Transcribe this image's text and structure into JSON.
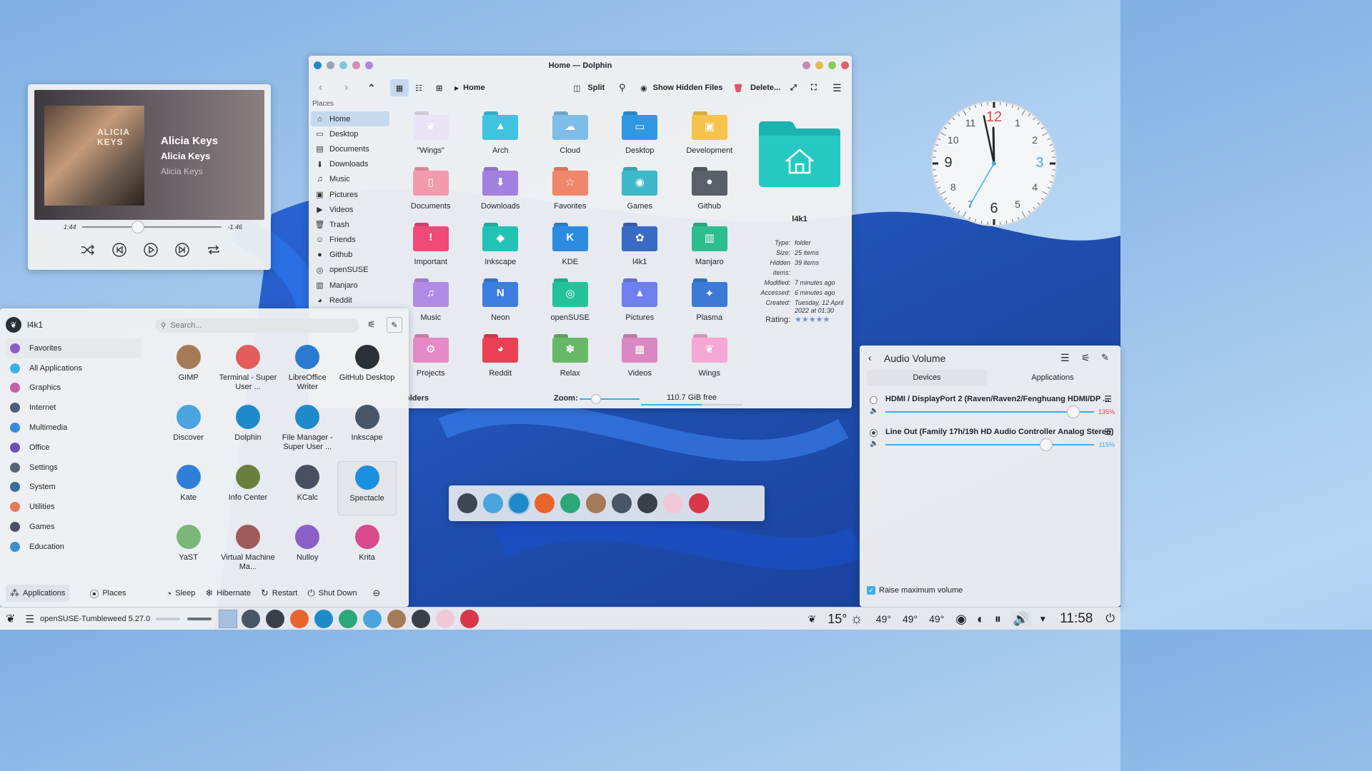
{
  "media_player": {
    "album_cover_text": "ALICIA KEYS",
    "title": "Alicia Keys",
    "album": "Alicia Keys",
    "artist": "Alicia Keys",
    "elapsed": "1:44",
    "remaining": "-1:46",
    "progress_fraction": 0.49
  },
  "dolphin": {
    "window_title": "Home — Dolphin",
    "breadcrumb": "Home",
    "toolbar": {
      "split": "Split",
      "show_hidden": "Show Hidden Files",
      "delete": "Delete..."
    },
    "places_header": "Places",
    "places": [
      "Home",
      "Desktop",
      "Documents",
      "Downloads",
      "Music",
      "Pictures",
      "Videos",
      "Trash",
      "Friends",
      "Github",
      "openSUSE",
      "Manjaro",
      "Reddit"
    ],
    "folders": [
      {
        "name": "\"Wings\"",
        "color": "#e9e4f5",
        "glyph": "❦"
      },
      {
        "name": "Arch",
        "color": "#3ec3e0",
        "glyph": "▲"
      },
      {
        "name": "Cloud",
        "color": "#7fbde9",
        "glyph": "☁"
      },
      {
        "name": "Desktop",
        "color": "#2f98e0",
        "glyph": "▭"
      },
      {
        "name": "Development",
        "color": "#f5c24c",
        "glyph": "▣"
      },
      {
        "name": "Documents",
        "color": "#f29aae",
        "glyph": "▯"
      },
      {
        "name": "Downloads",
        "color": "#a37fe0",
        "glyph": "⬇"
      },
      {
        "name": "Favorites",
        "color": "#f0866a",
        "glyph": "☆"
      },
      {
        "name": "Games",
        "color": "#3eb8c8",
        "glyph": "◉"
      },
      {
        "name": "Github",
        "color": "#5b5f69",
        "glyph": "●"
      },
      {
        "name": "Important",
        "color": "#ef4a78",
        "glyph": "!"
      },
      {
        "name": "Inkscape",
        "color": "#22c3b4",
        "glyph": "◆"
      },
      {
        "name": "KDE",
        "color": "#2c8ce0",
        "glyph": "K"
      },
      {
        "name": "l4k1",
        "color": "#3a6bc4",
        "glyph": "✿"
      },
      {
        "name": "Manjaro",
        "color": "#2ebd8e",
        "glyph": "▥"
      },
      {
        "name": "Music",
        "color": "#b28be6",
        "glyph": "♫"
      },
      {
        "name": "Neon",
        "color": "#3d7fe0",
        "glyph": "N"
      },
      {
        "name": "openSUSE",
        "color": "#25c29a",
        "glyph": "◎"
      },
      {
        "name": "Pictures",
        "color": "#6f7ff0",
        "glyph": "▲"
      },
      {
        "name": "Plasma",
        "color": "#3c7ad8",
        "glyph": "✦"
      },
      {
        "name": "Projects",
        "color": "#e58ac6",
        "glyph": "⚙"
      },
      {
        "name": "Reddit",
        "color": "#ea3f55",
        "glyph": "◕"
      },
      {
        "name": "Relax",
        "color": "#68b86a",
        "glyph": "✽"
      },
      {
        "name": "Videos",
        "color": "#d988c4",
        "glyph": "▦"
      },
      {
        "name": "Wings",
        "color": "#f5a8d4",
        "glyph": "❦"
      }
    ],
    "info": {
      "name": "l4k1",
      "props": [
        {
          "k": "Type:",
          "v": "folder"
        },
        {
          "k": "Size:",
          "v": "25 items"
        },
        {
          "k": "Hidden items:",
          "v": "39 items"
        },
        {
          "k": "Modified:",
          "v": "7 minutes ago"
        },
        {
          "k": "Accessed:",
          "v": "6 minutes ago"
        },
        {
          "k": "Created:",
          "v": "Tuesday, 12 April 2022 at 01:30"
        }
      ],
      "rating_label": "Rating:",
      "rating_stars": 5
    },
    "status_left": "olders",
    "zoom_label": "Zoom:",
    "free_space": "110.7 GiB free",
    "free_space_fraction": 0.6
  },
  "launcher": {
    "user": "l4k1",
    "search_placeholder": "Search...",
    "categories": [
      {
        "label": "Favorites",
        "color": "#8b5ec7"
      },
      {
        "label": "All Applications",
        "color": "#3daee9"
      },
      {
        "label": "Graphics",
        "color": "#c65ea8"
      },
      {
        "label": "Internet",
        "color": "#4b5d7a"
      },
      {
        "label": "Multimedia",
        "color": "#3b8ad9"
      },
      {
        "label": "Office",
        "color": "#6a4fb8"
      },
      {
        "label": "Settings",
        "color": "#5b6470"
      },
      {
        "label": "System",
        "color": "#3d6e9a"
      },
      {
        "label": "Utilities",
        "color": "#e07a5a"
      },
      {
        "label": "Games",
        "color": "#4a5068"
      },
      {
        "label": "Education",
        "color": "#3e8fc7"
      }
    ],
    "apps": [
      {
        "label": "GIMP",
        "color": "#a47a58"
      },
      {
        "label": "Terminal - Super User ...",
        "color": "#e25c5c"
      },
      {
        "label": "LibreOffice Writer",
        "color": "#2a7ad1"
      },
      {
        "label": "GitHub Desktop",
        "color": "#2b2f36"
      },
      {
        "label": "Discover",
        "color": "#4aa4e0"
      },
      {
        "label": "Dolphin",
        "color": "#1f8ac9"
      },
      {
        "label": "File Manager - Super User ...",
        "color": "#1f8ac9"
      },
      {
        "label": "Inkscape",
        "color": "#4a5568"
      },
      {
        "label": "Kate",
        "color": "#2f7fd8"
      },
      {
        "label": "Info Center",
        "color": "#6a7f3e"
      },
      {
        "label": "KCalc",
        "color": "#4a5060"
      },
      {
        "label": "Spectacle",
        "color": "#1b8fe0"
      },
      {
        "label": "YaST",
        "color": "#7cb77a"
      },
      {
        "label": "Virtual Machine Ma...",
        "color": "#a05a5a"
      },
      {
        "label": "Nulloy",
        "color": "#8a5fc8"
      },
      {
        "label": "Krita",
        "color": "#d84a8a"
      }
    ],
    "footer": {
      "applications": "Applications",
      "places": "Places",
      "sleep": "Sleep",
      "hibernate": "Hibernate",
      "restart": "Restart",
      "shutdown": "Shut Down"
    }
  },
  "audio": {
    "title": "Audio Volume",
    "tab_devices": "Devices",
    "tab_applications": "Applications",
    "devices": [
      {
        "name": "HDMI / DisplayPort 2 (Raven/Raven2/Fenghuang HDMI/DP ...",
        "volume": "135%",
        "fraction": 0.9,
        "color": "#da4453",
        "checked": false
      },
      {
        "name": "Line Out (Family 17h/19h HD Audio Controller Analog Stereo)",
        "volume": "115%",
        "fraction": 0.77,
        "color": "#3daee9",
        "checked": true
      }
    ],
    "raise_max": "Raise maximum volume"
  },
  "dock": {
    "colors": [
      "#3d4654",
      "#4aa4e0",
      "#1f8ac9",
      "#e8642c",
      "#2aa87a",
      "#a47a58",
      "#4a5568",
      "#3a3f4a",
      "#f0c8d8",
      "#d8384a"
    ]
  },
  "taskbar": {
    "task_title": "openSUSE-Tumbleweed 5.27.0",
    "icons": [
      "#4a5568",
      "#3a3f4a",
      "#e8642c",
      "#1f8ac9",
      "#2aa87a",
      "#4aa4e0",
      "#a47a58",
      "#3a3f4a",
      "#f0c8d8",
      "#d8384a"
    ],
    "weather_temp": "15°",
    "temps": [
      "49°",
      "49°",
      "49°"
    ],
    "time": "11:58"
  },
  "clock": {
    "numbers": [
      "12",
      "1",
      "2",
      "3",
      "4",
      "5",
      "6",
      "7",
      "8",
      "9",
      "10",
      "11"
    ],
    "hour": 11,
    "minute": 58,
    "second": 35
  }
}
